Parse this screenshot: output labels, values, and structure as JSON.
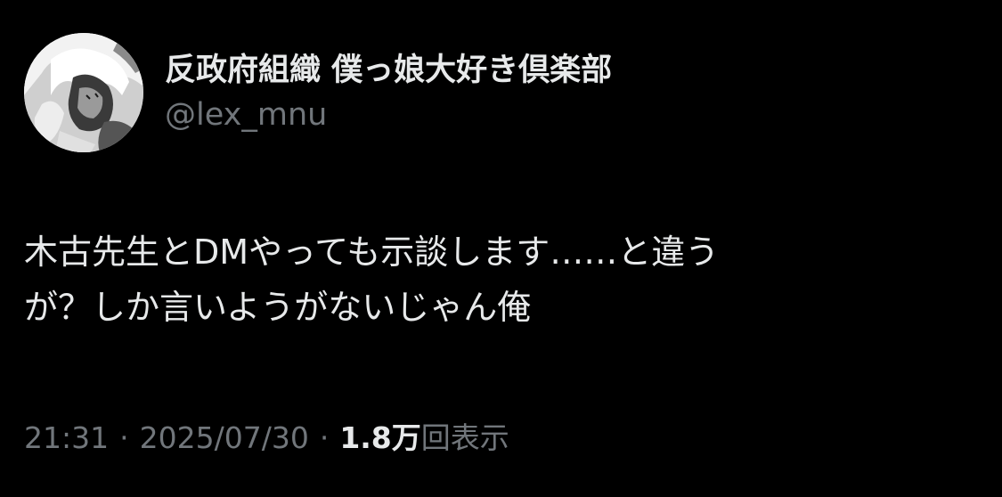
{
  "tweet": {
    "author": {
      "display_name": "反政府組織 僕っ娘大好き倶楽部",
      "handle": "@lex_mnu"
    },
    "text_lines": [
      "木古先生とDMやっても示談します……と違う",
      "が？しか言いようがないじゃん俺"
    ],
    "meta": {
      "time": "21:31",
      "separator": "·",
      "date": "2025/07/30",
      "views_count": "1.8万",
      "views_label": "回表示"
    }
  },
  "colors": {
    "background": "#000000",
    "primary_text": "#e7e9ea",
    "secondary_text": "#71767b"
  }
}
